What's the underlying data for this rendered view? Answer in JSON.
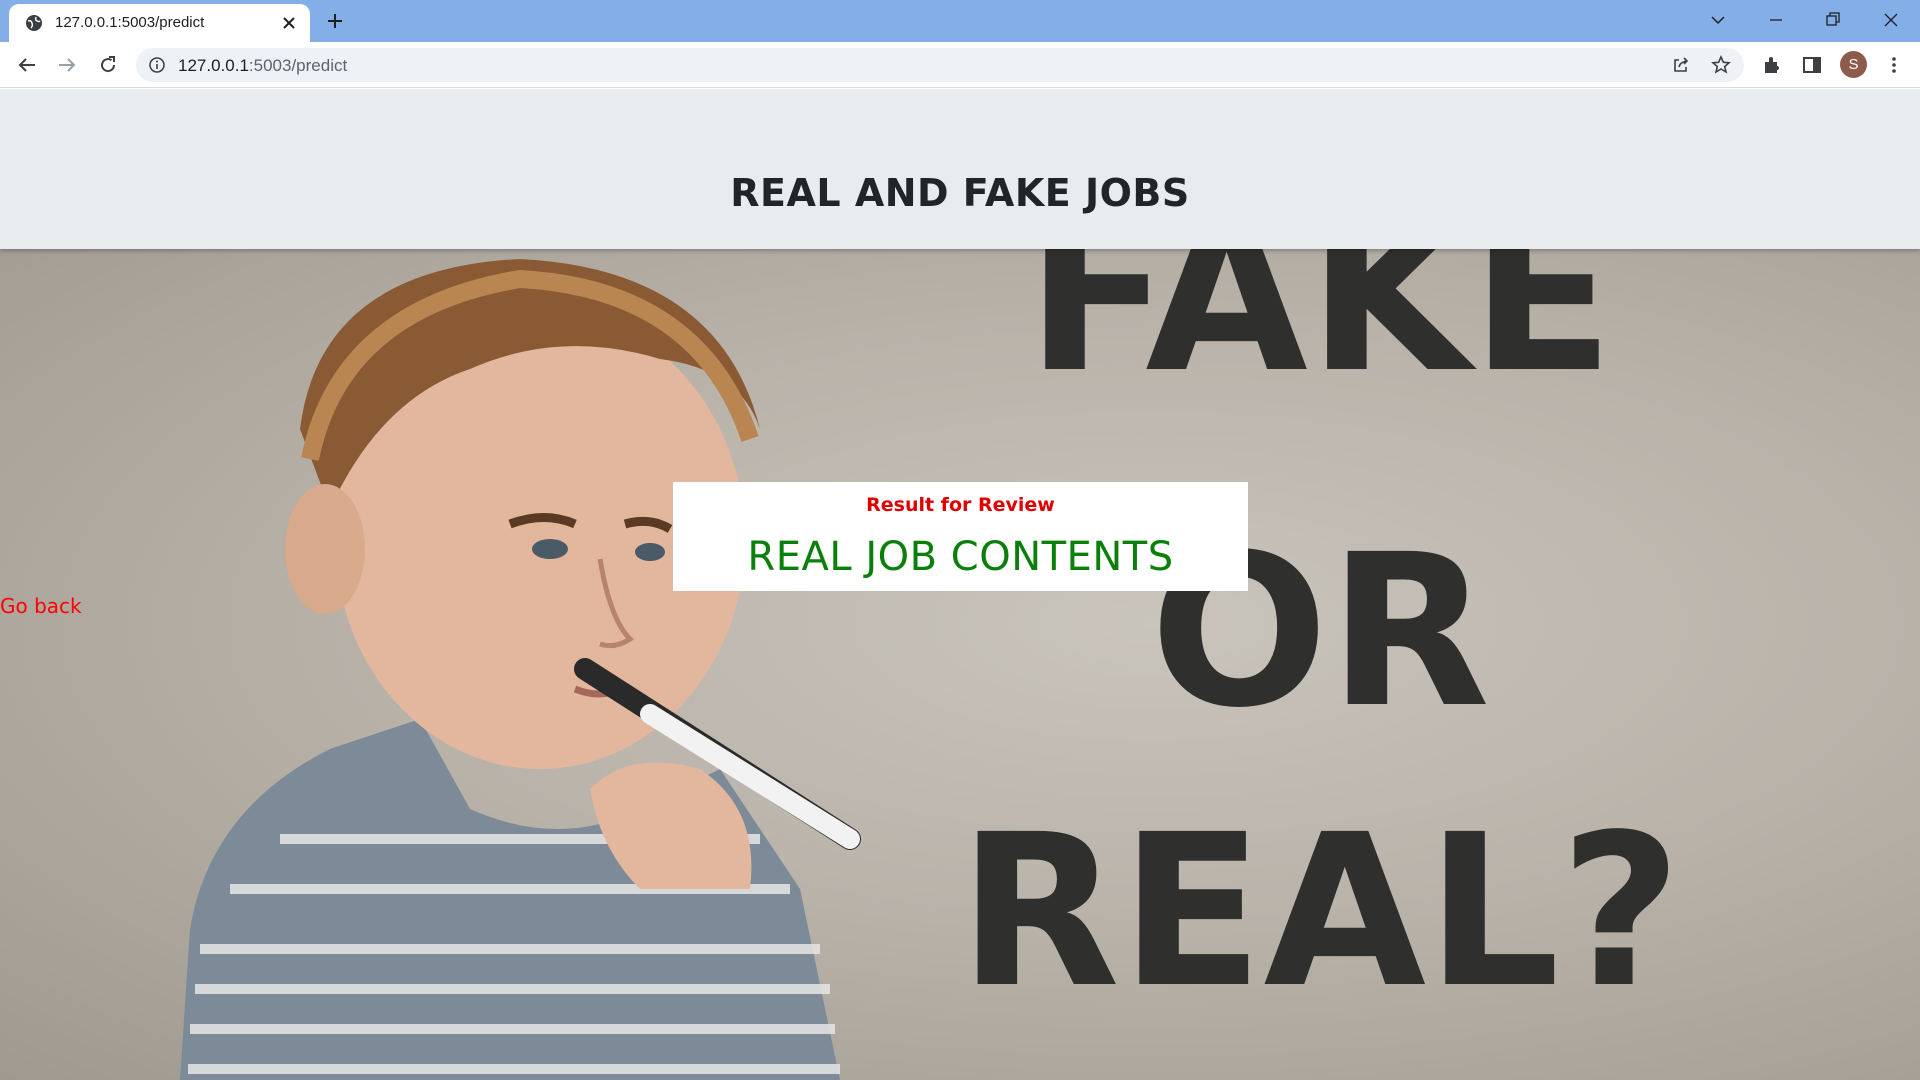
{
  "browser": {
    "tab_title": "127.0.0.1:5003/predict",
    "url_host": "127.0.0.1",
    "url_path": ":5003/predict",
    "avatar_letter": "S",
    "icons": [
      "globe-icon",
      "close-icon",
      "plus-icon",
      "chevron-down-icon",
      "minimize-icon",
      "restore-icon",
      "window-close-icon",
      "back-arrow-icon",
      "forward-arrow-icon",
      "reload-icon",
      "info-icon",
      "share-icon",
      "star-icon",
      "extensions-icon",
      "side-panel-icon",
      "kebab-menu-icon"
    ]
  },
  "page": {
    "title": "REAL AND FAKE JOBS",
    "result_label": "Result for Review",
    "result_value": "REAL JOB CONTENTS",
    "go_back": "Go back",
    "hero_text_lines": [
      "FAKE",
      "OR",
      "REAL?"
    ],
    "colors": {
      "header_bg": "#e9ecef",
      "result_label": "#e10000",
      "result_value": "#0a7f0a",
      "go_back": "#ff0000"
    }
  }
}
